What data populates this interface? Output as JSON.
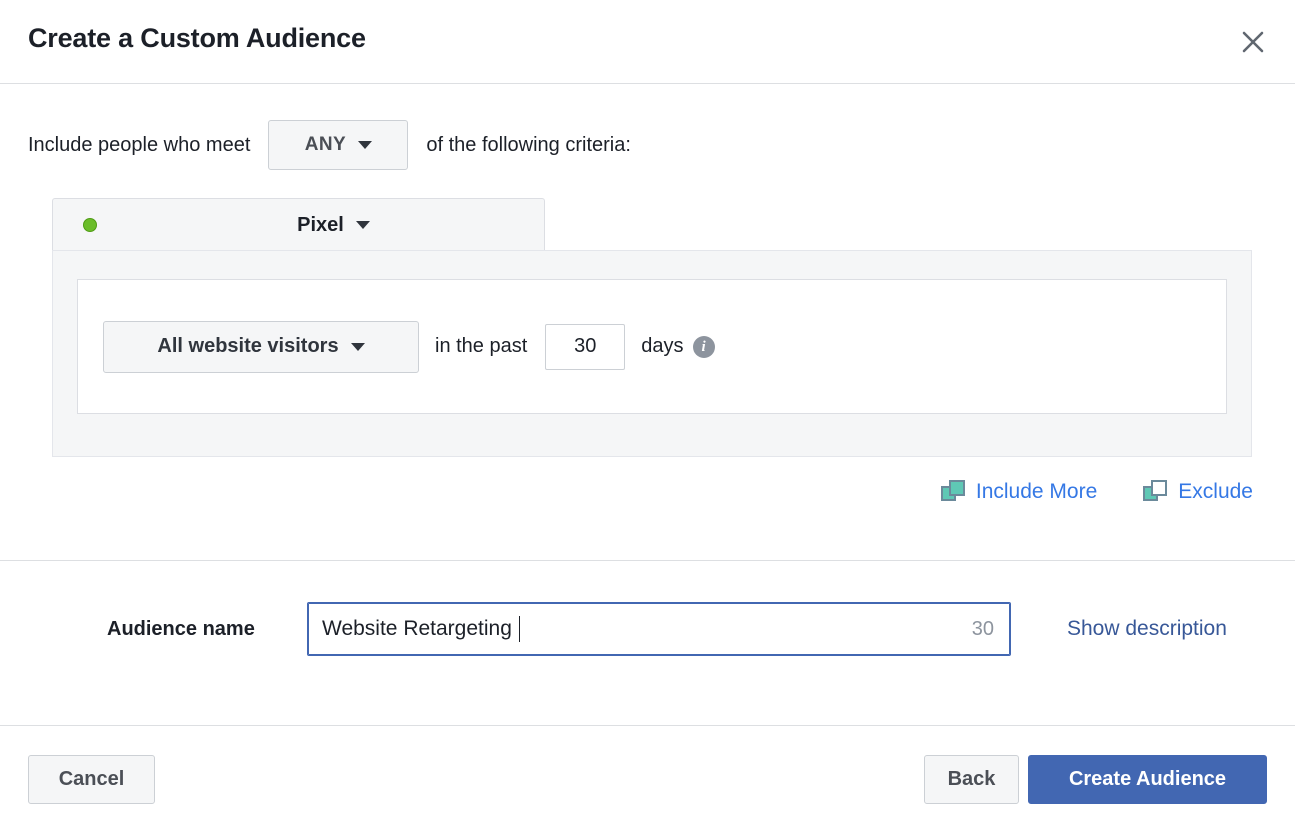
{
  "header": {
    "title": "Create a Custom Audience",
    "close_icon": "close-icon"
  },
  "criteria": {
    "prefix_text": "Include people who meet",
    "match_selector": {
      "value": "ANY",
      "caret_icon": "chevron-down-icon"
    },
    "suffix_text": "of the following criteria:"
  },
  "source_group": {
    "status_dot": "green-status-dot",
    "source_label": "Pixel",
    "source_caret_icon": "chevron-down-icon",
    "rule": {
      "event_selector": {
        "value": "All website visitors",
        "caret_icon": "chevron-down-icon"
      },
      "retention_prefix": "in the past",
      "retention_value": "30",
      "retention_unit": "days",
      "info_icon": "info-icon",
      "info_glyph": "i"
    }
  },
  "actions": {
    "include_more": {
      "label": "Include More",
      "icon": "two-filled-squares-icon"
    },
    "exclude": {
      "label": "Exclude",
      "icon": "filled-and-outlined-squares-icon"
    }
  },
  "audience_name": {
    "label": "Audience name",
    "value": "Website Retargeting",
    "placeholder": "Audience name",
    "chars_remaining": "30",
    "show_description_label": "Show description"
  },
  "footer": {
    "cancel_label": "Cancel",
    "back_label": "Back",
    "create_label": "Create Audience"
  },
  "colors": {
    "primary_blue": "#4267b2",
    "link_blue": "#3578e5",
    "navy_link": "#385898",
    "teal_icon": "#5fc8b5",
    "icon_outline": "#6b8a9b",
    "green_dot": "#6bbd2a",
    "panel_gray": "#f5f6f7",
    "border_gray": "#ccd0d5",
    "divider_gray": "#dddfe2"
  }
}
